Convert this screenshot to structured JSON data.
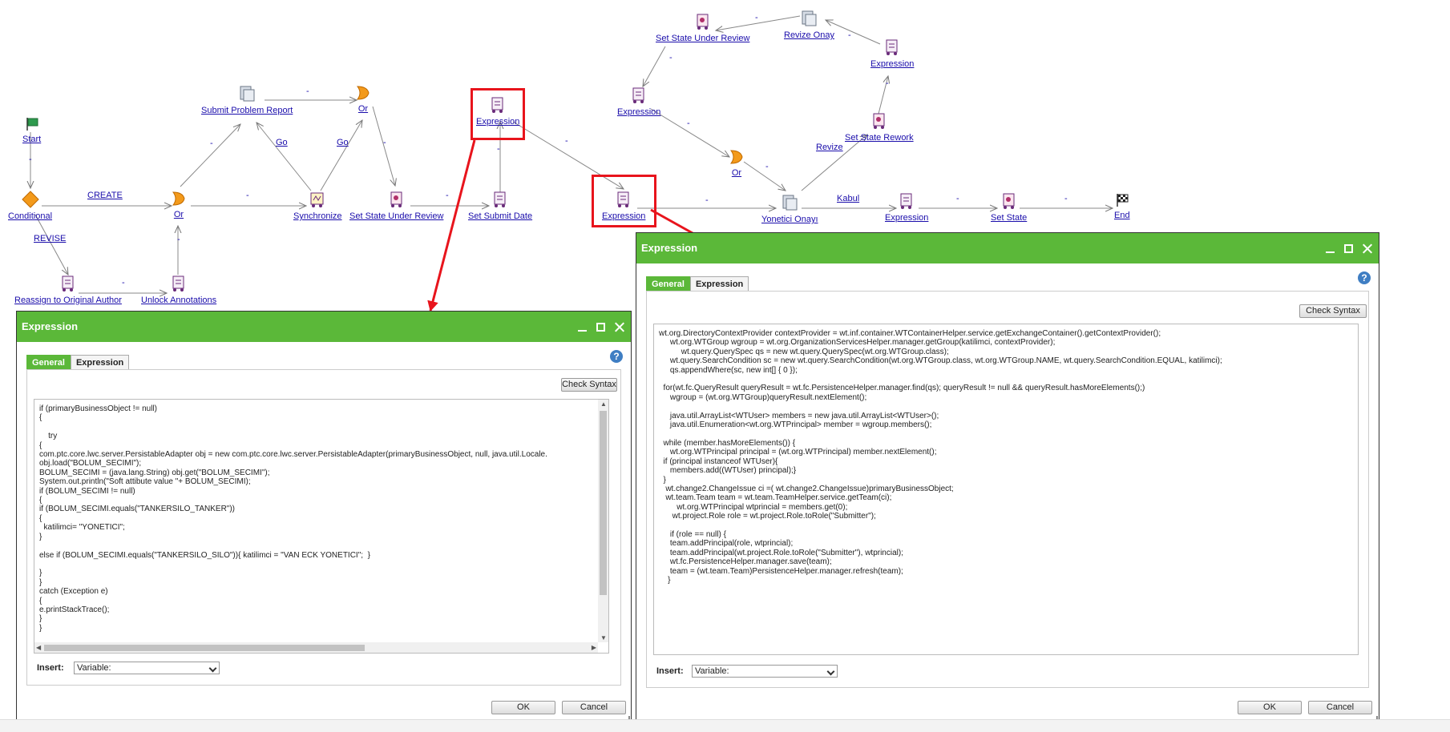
{
  "workflow": {
    "nodes": {
      "start": "Start",
      "conditional": "Conditional",
      "or1": "Or",
      "submit_problem_report": "Submit Problem Report",
      "or2": "Or",
      "synchronize": "Synchronize",
      "set_state_under_review1": "Set State Under Review",
      "set_submit_date": "Set Submit Date",
      "expression1": "Expression",
      "reassign": "Reassign to Original Author",
      "unlock_annotations": "Unlock Annotations",
      "expression2": "Expression",
      "set_state_under_review2": "Set State Under Review",
      "revize_onay": "Revize Onay",
      "expression3": "Expression",
      "set_state_rework": "Set State Rework",
      "expression4": "Expression",
      "or3": "Or",
      "yonetici_onayi": "Yonetici Onayı",
      "expression5": "Expression",
      "set_state": "Set State",
      "end": "End"
    },
    "edge_labels": {
      "dash": "-",
      "create": "CREATE",
      "revise": "REVISE",
      "go": "Go",
      "revize": "Revize",
      "kabul": "Kabul"
    }
  },
  "dialog_left": {
    "title": "Expression",
    "tabs": [
      "General",
      "Expression"
    ],
    "check_syntax": "Check Syntax",
    "code": "if (primaryBusinessObject != null)\n{\n\n    try\n{\ncom.ptc.core.lwc.server.PersistableAdapter obj = new com.ptc.core.lwc.server.PersistableAdapter(primaryBusinessObject, null, java.util.Locale.\nobj.load(\"BOLUM_SECIMI\");\nBOLUM_SECIMI = (java.lang.String) obj.get(\"BOLUM_SECIMI\");\nSystem.out.println(\"Soft attibute value \"+ BOLUM_SECIMI);\nif (BOLUM_SECIMI != null)\n{\nif (BOLUM_SECIMI.equals(\"TANKERSILO_TANKER\"))\n{\n  katilimci= \"YONETICI\";\n}\n\nelse if (BOLUM_SECIMI.equals(\"TANKERSILO_SILO\")){ katilimci = \"VAN ECK YONETICI\";  }\n\n}\n}\ncatch (Exception e)\n{\ne.printStackTrace();\n}\n}",
    "insert_label": "Insert:",
    "insert_value": "Variable:",
    "ok": "OK",
    "cancel": "Cancel"
  },
  "dialog_right": {
    "title": "Expression",
    "tabs": [
      "General",
      "Expression"
    ],
    "check_syntax": "Check Syntax",
    "code": "wt.org.DirectoryContextProvider contextProvider = wt.inf.container.WTContainerHelper.service.getExchangeContainer().getContextProvider();\n     wt.org.WTGroup wgroup = wt.org.OrganizationServicesHelper.manager.getGroup(katilimci, contextProvider);\n          wt.query.QuerySpec qs = new wt.query.QuerySpec(wt.org.WTGroup.class);\n     wt.query.SearchCondition sc = new wt.query.SearchCondition(wt.org.WTGroup.class, wt.org.WTGroup.NAME, wt.query.SearchCondition.EQUAL, katilimci);\n     qs.appendWhere(sc, new int[] { 0 });\n\n  for(wt.fc.QueryResult queryResult = wt.fc.PersistenceHelper.manager.find(qs); queryResult != null && queryResult.hasMoreElements();)\n     wgroup = (wt.org.WTGroup)queryResult.nextElement();\n\n     java.util.ArrayList<WTUser> members = new java.util.ArrayList<WTUser>();\n     java.util.Enumeration<wt.org.WTPrincipal> member = wgroup.members();\n\n  while (member.hasMoreElements()) {\n     wt.org.WTPrincipal principal = (wt.org.WTPrincipal) member.nextElement();\n  if (principal instanceof WTUser){\n     members.add((WTUser) principal);}\n  }\n   wt.change2.ChangeIssue ci =( wt.change2.ChangeIssue)primaryBusinessObject;\n   wt.team.Team team = wt.team.TeamHelper.service.getTeam(ci);\n        wt.org.WTPrincipal wtprincial = members.get(0);\n      wt.project.Role role = wt.project.Role.toRole(\"Submitter\");\n\n     if (role == null) {\n     team.addPrincipal(role, wtprincial);\n     team.addPrincipal(wt.project.Role.toRole(\"Submitter\"), wtprincial);\n     wt.fc.PersistenceHelper.manager.save(team);\n     team = (wt.team.Team)PersistenceHelper.manager.refresh(team);\n    }",
    "insert_label": "Insert:",
    "insert_value": "Variable:",
    "ok": "OK",
    "cancel": "Cancel"
  },
  "colors": {
    "title_bar": "#5bb839",
    "highlight": "#e8141c",
    "link": "#1a0dab"
  }
}
